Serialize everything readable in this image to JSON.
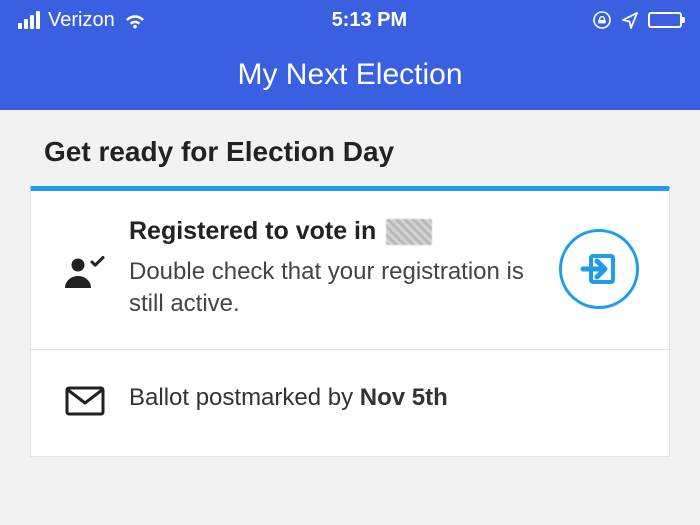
{
  "status_bar": {
    "carrier": "Verizon",
    "time": "5:13 PM"
  },
  "nav": {
    "title": "My Next Election"
  },
  "section": {
    "heading": "Get ready for Election Day"
  },
  "registration": {
    "title_prefix": "Registered to vote in ",
    "subtitle": "Double check that your registration is still active."
  },
  "ballot": {
    "text_prefix": "Ballot postmarked by ",
    "deadline": "Nov 5th"
  }
}
